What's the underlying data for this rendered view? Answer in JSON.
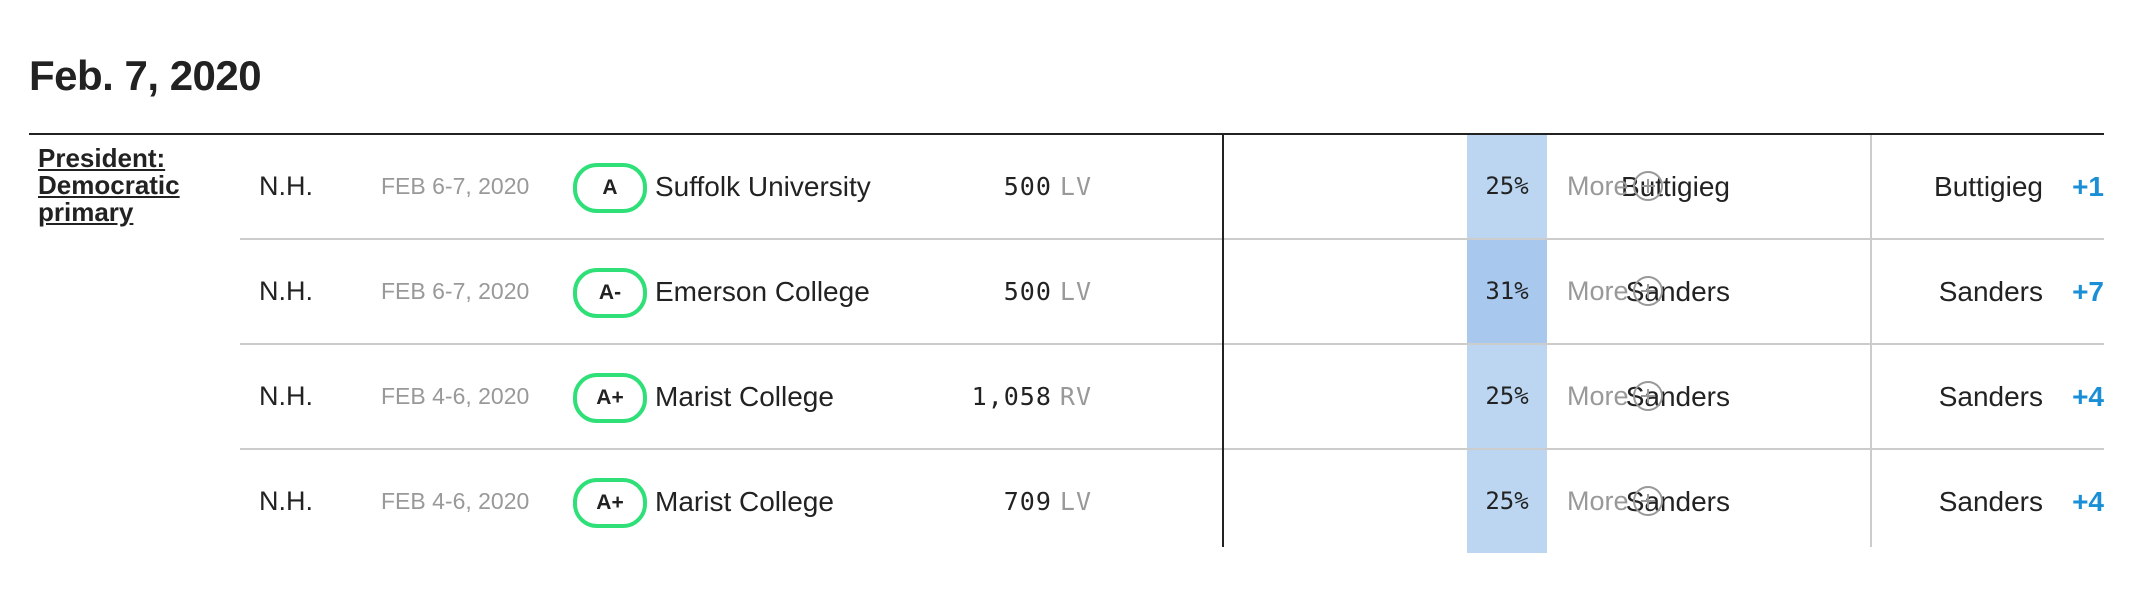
{
  "heading": "Feb. 7, 2020",
  "race": "President: Democratic primary",
  "colors": {
    "grade_border": "#2ee077",
    "net_text": "#1a8fd6",
    "bar_low": "#bcd6f1",
    "bar_high": "#a8c8ee",
    "muted_text": "#999999"
  },
  "polls": [
    {
      "state": "N.H.",
      "dates": "FEB 6-7, 2020",
      "grade": "A",
      "pollster": "Suffolk University",
      "sample": "500",
      "population": "LV",
      "leader": "Buttigieg",
      "pct": "25%",
      "pct_value": 25,
      "more": "More",
      "net_leader": "Buttigieg",
      "net": "+1"
    },
    {
      "state": "N.H.",
      "dates": "FEB 6-7, 2020",
      "grade": "A-",
      "pollster": "Emerson College",
      "sample": "500",
      "population": "LV",
      "leader": "Sanders",
      "pct": "31%",
      "pct_value": 31,
      "more": "More",
      "net_leader": "Sanders",
      "net": "+7"
    },
    {
      "state": "N.H.",
      "dates": "FEB 4-6, 2020",
      "grade": "A+",
      "pollster": "Marist College",
      "sample": "1,058",
      "population": "RV",
      "leader": "Sanders",
      "pct": "25%",
      "pct_value": 25,
      "more": "More",
      "net_leader": "Sanders",
      "net": "+4"
    },
    {
      "state": "N.H.",
      "dates": "FEB 4-6, 2020",
      "grade": "A+",
      "pollster": "Marist College",
      "sample": "709",
      "population": "LV",
      "leader": "Sanders",
      "pct": "25%",
      "pct_value": 25,
      "more": "More",
      "net_leader": "Sanders",
      "net": "+4"
    }
  ]
}
